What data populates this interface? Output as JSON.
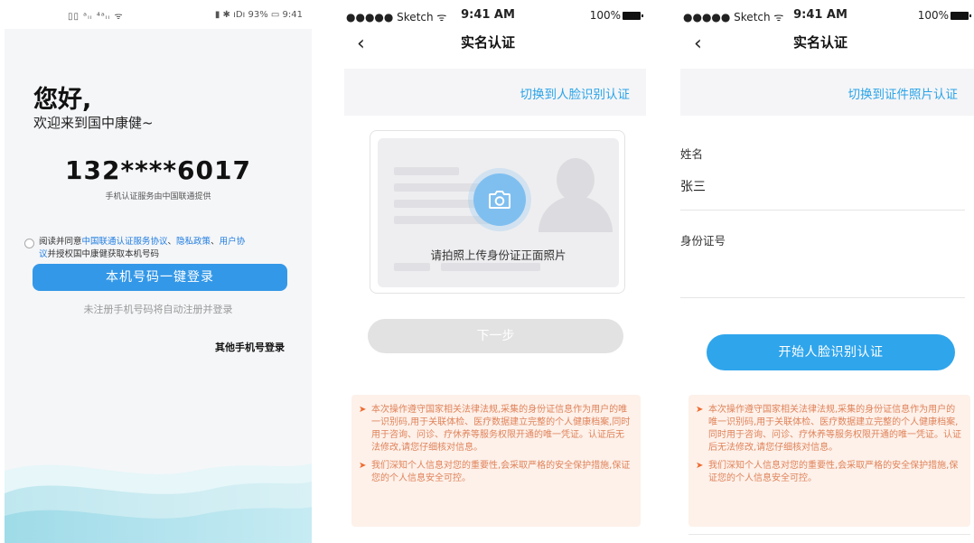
{
  "screen1": {
    "status_bar": {
      "left": "▯▯ ᵃᵢᵢ ⁴ᵃᵢᵢ ᯤ",
      "right": "▮ ✱ ıDı 93% ▭ 9:41"
    },
    "greeting": "您好,",
    "welcome": "欢迎来到国中康健~",
    "phone_number": "132****6017",
    "provider_note": "手机认证服务由中国联通提供",
    "agreement": {
      "prefix": "阅读并同意",
      "link1": "中国联通认证服务协议",
      "sep1": "、",
      "link2": "隐私政策",
      "sep2": "、",
      "link3_part1": "用户协",
      "link3_part2": "议",
      "suffix": "并授权国中康健获取本机号码"
    },
    "login_button": "本机号码一键登录",
    "auto_register_note": "未注册手机号码将自动注册并登录",
    "other_login": "其他手机号登录"
  },
  "screen2": {
    "status_bar": {
      "carrier": "●●●●● Sketch ᯤ",
      "time": "9:41 AM",
      "battery": "100%"
    },
    "title": "实名认证",
    "switch_link": "切换到人脸识别认证",
    "upload_prompt": "请拍照上传身份证正面照片",
    "next_button": "下一步",
    "notices": [
      "本次操作遵守国家相关法律法规,采集的身份证信息作为用户的唯一识别码,用于关联体检、医疗数据建立完整的个人健康档案,同时用于咨询、问诊、疗休养等服务权限开通的唯一凭证。认证后无法修改,请您仔细核对信息。",
      "我们深知个人信息对您的重要性,会采取严格的安全保护措施,保证您的个人信息安全可控。"
    ]
  },
  "screen3": {
    "status_bar": {
      "carrier": "●●●●● Sketch ᯤ",
      "time": "9:41 AM",
      "battery": "100%"
    },
    "title": "实名认证",
    "switch_link": "切换到证件照片认证",
    "name_label": "姓名",
    "name_value": "张三",
    "id_label": "身份证号",
    "id_value": "",
    "face_button": "开始人脸识别认证",
    "notices": [
      "本次操作遵守国家相关法律法规,采集的身份证信息作为用户的唯一识别码,用于关联体检、医疗数据建立完整的个人健康档案,同时用于咨询、问诊、疗休养等服务权限开通的唯一凭证。认证后无法修改,请您仔细核对信息。",
      "我们深知个人信息对您的重要性,会采取严格的安全保护措施,保证您的个人信息安全可控。"
    ]
  },
  "colors": {
    "primary_blue": "#3498e8",
    "link_blue": "#2aa4e8",
    "notice_bg": "#fdf1ea",
    "notice_text": "#e0835a",
    "disabled_button": "#e2e2e2"
  }
}
